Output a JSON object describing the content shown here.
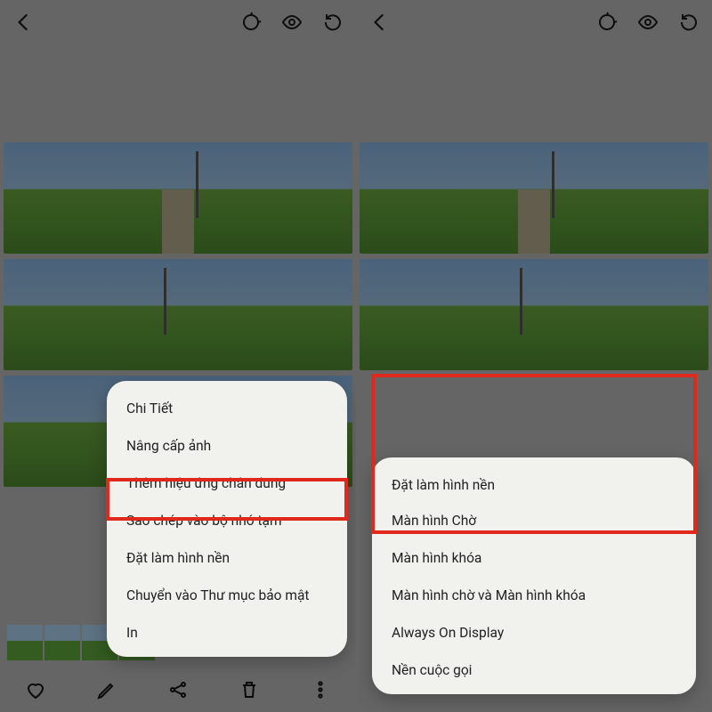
{
  "left": {
    "menu": {
      "items": [
        "Chi Tiết",
        "Nâng cấp ảnh",
        "Thêm hiệu ứng chân dung",
        "Sao chép vào bộ nhớ tạm",
        "Đặt làm hình nền",
        "Chuyển vào Thư mục bảo mật",
        "In"
      ]
    }
  },
  "right": {
    "menu": {
      "header": "Đặt làm hình nền",
      "items": [
        "Màn hình Chờ",
        "Màn hình khóa",
        "Màn hình chờ và Màn hình khóa",
        "Always On Display",
        "Nền cuộc gọi"
      ]
    }
  }
}
